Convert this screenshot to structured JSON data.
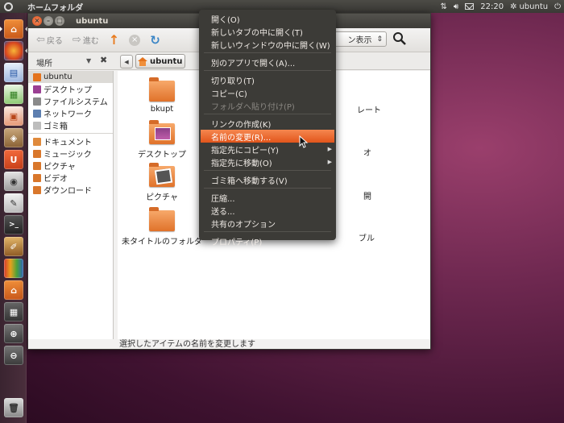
{
  "top_panel": {
    "app_title": "ホームフォルダ",
    "clock": "22:20",
    "user": "ubuntu"
  },
  "launcher": {
    "items": [
      "home-folder",
      "firefox",
      "writer",
      "calc",
      "impress",
      "software-center",
      "ubuntu-one",
      "camera",
      "text-editor",
      "terminal",
      "graphics",
      "color-pencils",
      "home-folder-2",
      "workspace-switcher",
      "zoom-in",
      "zoom-out",
      "trash"
    ]
  },
  "window": {
    "title": "ubuntu",
    "toolbar": {
      "back_label": "戻る",
      "forward_label": "進む",
      "view_mode_label": "ン表示"
    },
    "locationbar": {
      "places_label": "場所",
      "breadcrumb": "ubuntu"
    },
    "sidebar": {
      "group1": [
        {
          "label": "ubuntu",
          "icon": "home-icon",
          "selected": true
        },
        {
          "label": "デスクトップ",
          "icon": "desktop-icon"
        },
        {
          "label": "ファイルシステム",
          "icon": "drive-icon"
        },
        {
          "label": "ネットワーク",
          "icon": "network-icon"
        },
        {
          "label": "ゴミ箱",
          "icon": "trash-icon"
        }
      ],
      "group2": [
        {
          "label": "ドキュメント",
          "icon": "documents-icon"
        },
        {
          "label": "ミュージック",
          "icon": "music-icon"
        },
        {
          "label": "ピクチャ",
          "icon": "pictures-icon"
        },
        {
          "label": "ビデオ",
          "icon": "videos-icon"
        },
        {
          "label": "ダウンロード",
          "icon": "downloads-icon"
        }
      ]
    },
    "files": [
      {
        "label": "bkupt",
        "icon": "folder"
      },
      {
        "label": "デスクトップ",
        "icon": "folder-desktop"
      },
      {
        "label": "ピクチャ",
        "icon": "folder-pictures"
      },
      {
        "label": "未タイトルのフォルダ",
        "icon": "folder"
      }
    ],
    "partial_labels": [
      "レート",
      "オ",
      "開",
      "ブル"
    ],
    "status": "選択したアイテムの名前を変更します"
  },
  "context_menu": {
    "items": [
      {
        "label": "開く(O)"
      },
      {
        "label": "新しいタブの中に開く(T)"
      },
      {
        "label": "新しいウィンドウの中に開く(W)"
      },
      {
        "sep": true
      },
      {
        "label": "別のアプリで開く(A)..."
      },
      {
        "sep": true
      },
      {
        "label": "切り取り(T)"
      },
      {
        "label": "コピー(C)"
      },
      {
        "label": "フォルダへ貼り付け(P)",
        "disabled": true
      },
      {
        "sep": true
      },
      {
        "label": "リンクの作成(K)"
      },
      {
        "label": "名前の変更(R)...",
        "highlight": true
      },
      {
        "label": "指定先にコピー(Y)",
        "submenu": true
      },
      {
        "label": "指定先に移動(O)",
        "submenu": true
      },
      {
        "sep": true
      },
      {
        "label": "ゴミ箱へ移動する(V)"
      },
      {
        "sep": true
      },
      {
        "label": "圧縮..."
      },
      {
        "label": "送る..."
      },
      {
        "label": "共有のオプション"
      },
      {
        "sep": true
      },
      {
        "label": "プロパティ(P)"
      }
    ]
  },
  "colors": {
    "accent": "#e2551b",
    "menu_bg": "#3c3b37",
    "panel_bg": "#3c3b37"
  }
}
